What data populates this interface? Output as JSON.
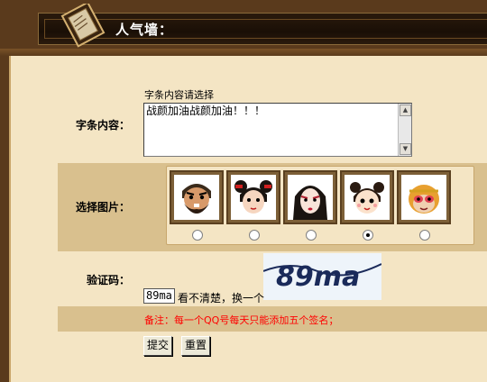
{
  "header": {
    "title": "人气墙："
  },
  "form": {
    "content_label": "字条内容：",
    "content_hint": "字条内容请选择",
    "content_value": "战颜加油战颜加油！！！",
    "picture_label": "选择图片：",
    "avatars": [
      {
        "name": "bearded-warrior",
        "selected": false
      },
      {
        "name": "twin-bun-girl",
        "selected": false
      },
      {
        "name": "opera-lady",
        "selected": false
      },
      {
        "name": "cute-girl",
        "selected": true
      },
      {
        "name": "monkey-king",
        "selected": false
      }
    ],
    "captcha_label": "验证码：",
    "captcha_image_text": "89ma",
    "captcha_value": "89ma",
    "refresh_text": "看不清楚，换一个",
    "note": "备注：每一个QQ号每天只能添加五个签名；",
    "submit_label": "提交",
    "reset_label": "重置"
  }
}
